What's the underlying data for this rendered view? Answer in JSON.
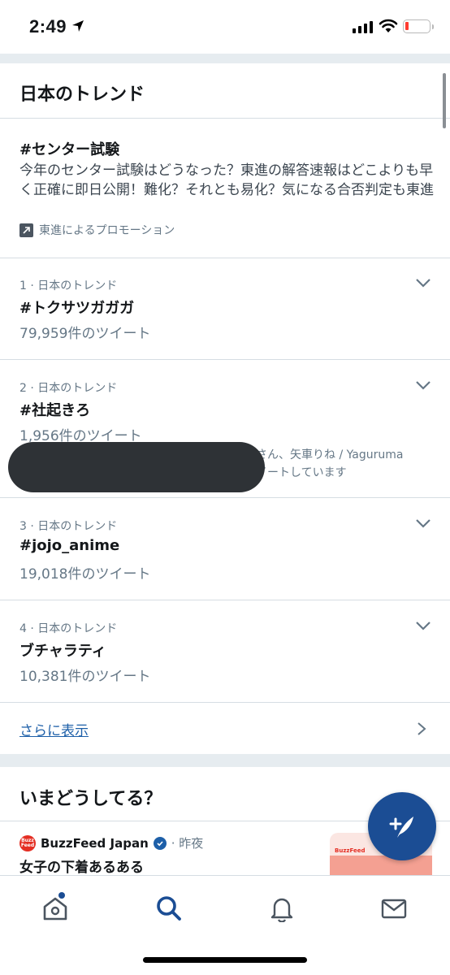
{
  "status_bar": {
    "time": "2:49"
  },
  "trends": {
    "section_title": "日本のトレンド",
    "promoted": {
      "title": "#センター試験",
      "description": "今年のセンター試験はどうなった？東進の解答速報はどこよりも早く正確に即日公開！難化？それとも易化？気になる合否判定も東進",
      "promoted_by": "東進によるプロモーション"
    },
    "items": [
      {
        "context": "1 · 日本のトレンド",
        "name": "#トクサツガガガ",
        "count": "79,959件のツイート"
      },
      {
        "context": "2 · 日本のトレンド",
        "name": "#社起きろ",
        "count": "1,956件のツイート",
        "extra_line1": "さん、矢車りね / Yaguruma",
        "extra_line2": "イートしています"
      },
      {
        "context": "3 · 日本のトレンド",
        "name": "#jojo_anime",
        "count": "19,018件のツイート"
      },
      {
        "context": "4 · 日本のトレンド",
        "name": "ブチャラティ",
        "count": "10,381件のツイート"
      }
    ],
    "show_more": "さらに表示"
  },
  "whats_happening": {
    "section_title": "いまどうしてる？",
    "news": {
      "logo_text": "Buzz Feed",
      "source": "BuzzFeed Japan",
      "time": "· 昨夜",
      "headline": "女子の下着あるある",
      "thumb_text": "BuzzFeed"
    }
  },
  "tab_bar": {
    "tabs": [
      {
        "name": "home",
        "icon": "home-icon"
      },
      {
        "name": "search",
        "icon": "search-icon"
      },
      {
        "name": "notifications",
        "icon": "bell-icon"
      },
      {
        "name": "messages",
        "icon": "mail-icon"
      }
    ]
  },
  "colors": {
    "accent": "#1b4d94",
    "link": "#1d5fa8",
    "secondary_text": "#657786",
    "separator_band": "#e6ecf0"
  }
}
